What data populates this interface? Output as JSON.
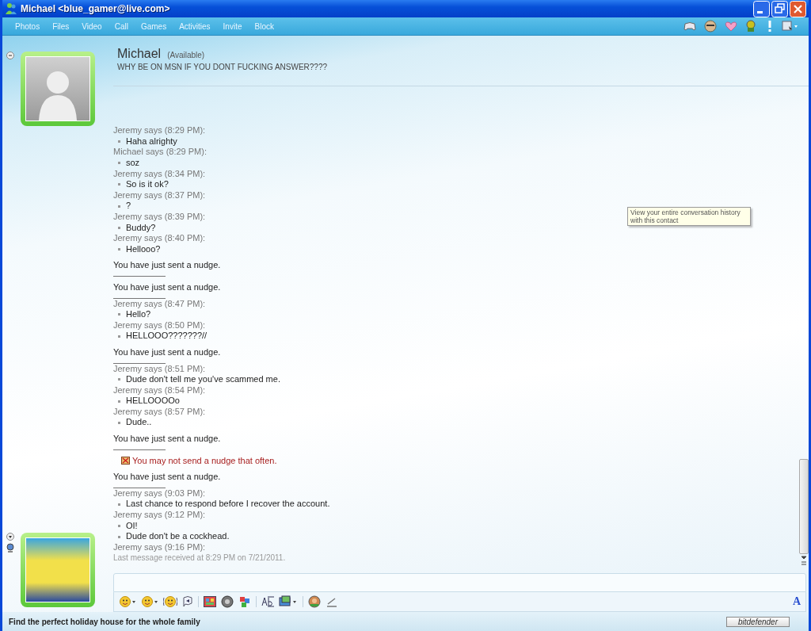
{
  "window": {
    "title": "Michael <blue_gamer@live.com>"
  },
  "menu": [
    "Photos",
    "Files",
    "Video",
    "Call",
    "Games",
    "Activities",
    "Invite",
    "Block"
  ],
  "contact": {
    "name": "Michael",
    "status": "(Available)",
    "personal_message": "WHY BE ON MSN IF YOU DONT FUCKING ANSWER????"
  },
  "chat": [
    {
      "kind": "header",
      "text": "Jeremy says (8:29 PM):"
    },
    {
      "kind": "message",
      "text": "Haha alrighty"
    },
    {
      "kind": "header",
      "text": "Michael says (8:29 PM):"
    },
    {
      "kind": "message",
      "text": "soz"
    },
    {
      "kind": "header",
      "text": "Jeremy says (8:34 PM):"
    },
    {
      "kind": "message",
      "text": "So is it ok?"
    },
    {
      "kind": "header",
      "text": "Jeremy says (8:37 PM):"
    },
    {
      "kind": "message",
      "text": "?"
    },
    {
      "kind": "header",
      "text": "Jeremy says (8:39 PM):"
    },
    {
      "kind": "message",
      "text": "Buddy?"
    },
    {
      "kind": "header",
      "text": "Jeremy says (8:40 PM):"
    },
    {
      "kind": "message",
      "text": "Hellooo?"
    },
    {
      "kind": "nudge",
      "text": "You have just sent a nudge."
    },
    {
      "kind": "nudge",
      "text": "You have just sent a nudge."
    },
    {
      "kind": "header",
      "text": "Jeremy says (8:47 PM):"
    },
    {
      "kind": "message",
      "text": "Hello?"
    },
    {
      "kind": "header",
      "text": "Jeremy says (8:50 PM):"
    },
    {
      "kind": "message",
      "text": "HELLOOO???????//"
    },
    {
      "kind": "nudge",
      "text": "You have just sent a nudge."
    },
    {
      "kind": "header",
      "text": "Jeremy says (8:51 PM):"
    },
    {
      "kind": "message",
      "text": "Dude don't tell me you've scammed me."
    },
    {
      "kind": "header",
      "text": "Jeremy says (8:54 PM):"
    },
    {
      "kind": "message",
      "text": "HELLOOOOo"
    },
    {
      "kind": "header",
      "text": "Jeremy says (8:57 PM):"
    },
    {
      "kind": "message",
      "text": "Dude.."
    },
    {
      "kind": "nudge",
      "text": "You have just sent a nudge."
    },
    {
      "kind": "warning",
      "text": "You may not send a nudge that often."
    },
    {
      "kind": "nudge",
      "text": "You have just sent a nudge."
    },
    {
      "kind": "header",
      "text": "Jeremy says (9:03 PM):"
    },
    {
      "kind": "message",
      "text": "Last chance to respond before I recover the account."
    },
    {
      "kind": "header",
      "text": "Jeremy says (9:12 PM):"
    },
    {
      "kind": "message",
      "text": "OI!"
    },
    {
      "kind": "message",
      "text": "Dude don't be a cockhead."
    },
    {
      "kind": "header",
      "text": "Jeremy says (9:16 PM):"
    },
    {
      "kind": "info",
      "text": "Last message received at 8:29 PM on 7/21/2011."
    }
  ],
  "tooltip": {
    "text": "View your entire conversation history with this contact"
  },
  "font_button": "A",
  "status_bar": {
    "ad": "Find the perfect holiday house for the whole family",
    "badge": "bitdefender"
  }
}
